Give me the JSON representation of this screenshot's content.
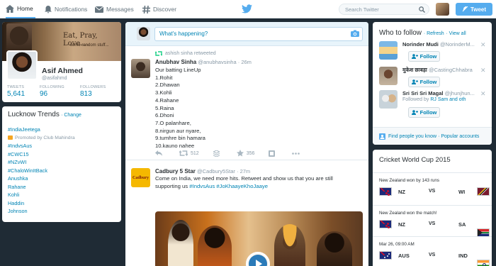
{
  "nav": {
    "home": "Home",
    "notifications": "Notifications",
    "messages": "Messages",
    "discover": "Discover",
    "search_placeholder": "Search Twitter",
    "tweet_button": "Tweet"
  },
  "profile": {
    "banner_text": "Eat, Pray, Love....",
    "banner_subtext": "some random stuff...",
    "name": "Asif Ahmed",
    "handle": "@asifahmd",
    "stats": [
      {
        "label": "TWEETS",
        "value": "5,641"
      },
      {
        "label": "FOLLOWING",
        "value": "96"
      },
      {
        "label": "FOLLOWERS",
        "value": "813"
      }
    ]
  },
  "trends": {
    "title": "Lucknow Trends",
    "change": "· Change",
    "items": [
      "#IndiaJeetega",
      "#IndvsAus",
      "#CWC15",
      "#NZvWI",
      "#ChaloWinItBack",
      "Anushka",
      "Rahane",
      "Kohli",
      "Haddin",
      "Johnson"
    ],
    "promoted_text": "Promoted by Club Mahindra"
  },
  "compose": {
    "placeholder": "What's happening?"
  },
  "tweets": [
    {
      "retweet_line": "ashish sinha retweeted",
      "name": "Anubhav Sinha",
      "handle": "@anubhavsinha",
      "time": "· 26m",
      "lines": [
        "Our batting LineUp",
        "1.Rohit",
        "2.Dhawan",
        "3.Kohli",
        "4.Rahane",
        "5.Raina",
        "6.Dhoni",
        "7.O palanhare,",
        "8.nirgun aur nyare,",
        "9.tumhre bin hamara",
        "10.kauno nahee"
      ],
      "retweets": "512",
      "favorites": "356"
    },
    {
      "avatar_text": "Cadbury",
      "name": "Cadbury 5 Star",
      "handle": "@Cadbury5Star",
      "time": "· 27m",
      "text_line1": "Come on India, we need more hits. Retweet and show us that you are still",
      "text_line2_prefix": "supporting us ",
      "hashtags": "#IndvsAus #JoKhaayeKhoJaaye"
    }
  ],
  "who_to_follow": {
    "title": "Who to follow",
    "refresh": "· Refresh",
    "view_all": "· View all",
    "follow_label": "Follow",
    "users": [
      {
        "name": "Norinder Mudi",
        "handle": "@NorinderM..."
      },
      {
        "name": "मुकेश छाबड़ा",
        "handle": "@CastingChhabra"
      },
      {
        "name": "Sri Sri Sri Magal",
        "handle": "@jhunjhun...",
        "followed_by": "Followed by",
        "followed_names": "RJ Sam and oth"
      }
    ],
    "find_people": "Find people you know",
    "popular": "· Popular accounts"
  },
  "cricket": {
    "title": "Cricket World Cup 2015",
    "vs": "VS",
    "matches": [
      {
        "status": "New Zealand won by 143 runs",
        "team1": "NZ",
        "team2": "WI"
      },
      {
        "status": "New Zealand won the match!",
        "team1": "NZ",
        "team2": "SA"
      },
      {
        "status": "Mar 26, 09:00 AM",
        "team1": "AUS",
        "team2": "IND"
      }
    ]
  },
  "colors": {
    "accent": "#55acee",
    "link": "#0084b4",
    "background": "#1f2b35"
  }
}
